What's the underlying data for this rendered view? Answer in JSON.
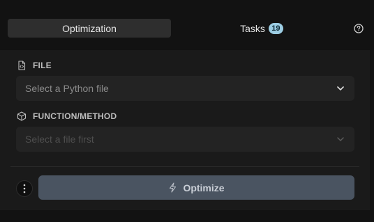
{
  "tabs": [
    {
      "label": "Optimization",
      "active": true
    },
    {
      "label": "Tasks",
      "badge": "19",
      "active": false
    }
  ],
  "help": {
    "icon": "help-circle-icon"
  },
  "file_section": {
    "label": "FILE",
    "icon": "file-code-icon",
    "placeholder": "Select a Python file"
  },
  "function_section": {
    "label": "FUNCTION/METHOD",
    "icon": "cube-icon",
    "placeholder": "Select a file first",
    "disabled": true
  },
  "actions": {
    "more_icon": "vertical-dots-icon",
    "optimize_label": "Optimize",
    "optimize_icon": "lightning-icon"
  },
  "colors": {
    "background": "#121212",
    "panel": "#1a1a1a",
    "active_tab": "#2e2e2e",
    "badge": "#9ccde3",
    "optimize_button": "#4a5461"
  }
}
